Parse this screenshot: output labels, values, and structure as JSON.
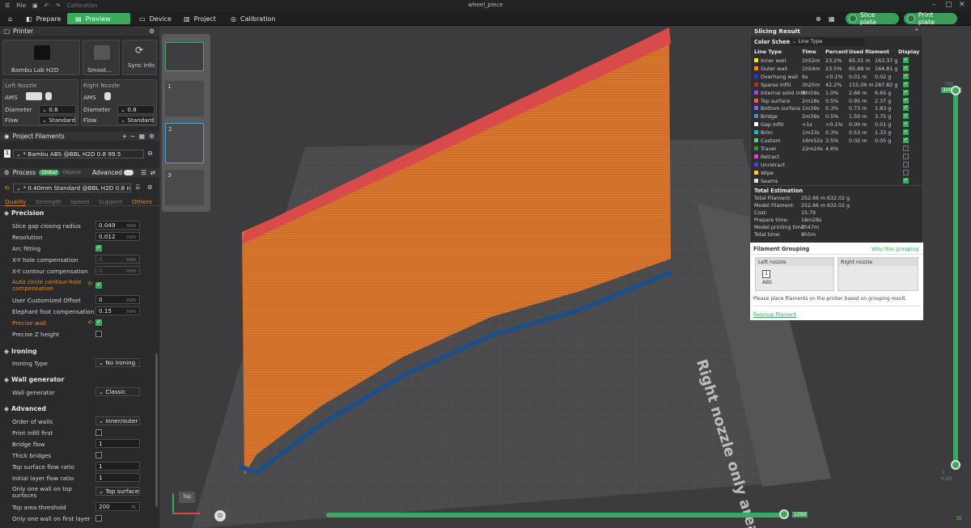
{
  "titlebar": {
    "file_menu": "File",
    "calibration": "Calibration",
    "title": "wheel_piece"
  },
  "tabs": {
    "prepare": "Prepare",
    "preview": "Preview",
    "device": "Device",
    "project": "Project",
    "calibration": "Calibration"
  },
  "actions": {
    "slice_plate": "Slice plate",
    "print_plate": "Print plate"
  },
  "printer": {
    "header": "Printer",
    "model": "Bambu Lab H2D",
    "plate": "Smoot...",
    "sync": "Sync info",
    "left_nozzle": {
      "title": "Left Nozzle",
      "ams": "AMS",
      "diameter_label": "Diameter",
      "diameter": "0.8",
      "flow_label": "Flow",
      "flow": "Standard"
    },
    "right_nozzle": {
      "title": "Right Nozzle",
      "ams": "AMS",
      "diameter_label": "Diameter",
      "diameter": "0.8",
      "flow_label": "Flow",
      "flow": "Standard"
    }
  },
  "filaments": {
    "header": "Project Filaments",
    "item_index": "1",
    "item": "* Bambu ABS @BBL H2D 0.8 99.5"
  },
  "process": {
    "header": "Process",
    "global": "Global",
    "objects": "Objects",
    "advanced": "Advanced",
    "preset": "* 0.40mm Standard @BBL H2D 0.8 noz...",
    "tabs": [
      "Quality",
      "Strength",
      "Speed",
      "Support",
      "Others"
    ]
  },
  "settings": {
    "precision": "Precision",
    "slice_gap_label": "Slice gap closing radius",
    "slice_gap": "0.049",
    "unit_mm": "mm",
    "resolution_label": "Resolution",
    "resolution": "0.012",
    "arc_fitting_label": "Arc fitting",
    "xy_hole_label": "X-Y hole compensation",
    "xy_hole": "0",
    "xy_contour_label": "X-Y contour compensation",
    "xy_contour": "0",
    "auto_circle_label": "Auto circle contour-hole compensation",
    "user_offset_label": "User Customized Offset",
    "user_offset": "0",
    "elephant_label": "Elephant foot compensation",
    "elephant": "0.15",
    "precise_wall_label": "Precise wall",
    "precise_z_label": "Precise Z height",
    "ironing": "Ironing",
    "ironing_type_label": "Ironing Type",
    "ironing_type": "No ironing",
    "wall_gen": "Wall generator",
    "wall_gen_label": "Wall generator",
    "wall_gen_value": "Classic",
    "advanced": "Advanced",
    "order_walls_label": "Order of walls",
    "order_walls": "inner/outer",
    "infill_first_label": "Print infill first",
    "bridge_flow_label": "Bridge flow",
    "bridge_flow": "1",
    "thick_bridges_label": "Thick bridges",
    "top_flow_label": "Top surface flow ratio",
    "top_flow": "1",
    "initial_flow_label": "Initial layer flow ratio",
    "initial_flow": "1",
    "one_wall_top_label": "Only one wall on top surfaces",
    "one_wall_top": "Top surfaces",
    "top_area_label": "Top area threshold",
    "top_area": "200",
    "unit_pct": "%",
    "one_wall_first_label": "Only one wall on first layer"
  },
  "plates": [
    "1",
    "2",
    "3"
  ],
  "viewport": {
    "right_nozzle_text": "Right nozzle only area",
    "layer_top": "750",
    "layer_top_h": "300.00",
    "layer_bottom": "1",
    "layer_bottom_h": "0.40",
    "move_value": "1290",
    "view_label": "Top"
  },
  "slicing": {
    "header": "Slicing Result",
    "color_scheme_label": "Color Scheme",
    "color_scheme": "Line Type",
    "cols": [
      "Line Type",
      "Time",
      "Percent",
      "Used filament",
      "",
      "Display"
    ],
    "rows": [
      {
        "name": "Inner wall",
        "color": "#e8e63a",
        "time": "1h52m",
        "pct": "23.2%",
        "m": "65.31 m",
        "g": "163.37 g",
        "on": true
      },
      {
        "name": "Outer wall",
        "color": "#f28c1a",
        "time": "1h54m",
        "pct": "23.5%",
        "m": "65.88 m",
        "g": "164.81 g",
        "on": true
      },
      {
        "name": "Overhang wall",
        "color": "#2a33d8",
        "time": "6s",
        "pct": "<0.1%",
        "m": "0.01 m",
        "g": "0.02 g",
        "on": true
      },
      {
        "name": "Sparse infill",
        "color": "#b03030",
        "time": "3h25m",
        "pct": "42.2%",
        "m": "115.06 m",
        "g": "287.82 g",
        "on": true
      },
      {
        "name": "Internal solid infill",
        "color": "#9a4fcf",
        "time": "4m59s",
        "pct": "1.0%",
        "m": "2.66 m",
        "g": "6.65 g",
        "on": true
      },
      {
        "name": "Top surface",
        "color": "#f25a5a",
        "time": "2m18s",
        "pct": "0.5%",
        "m": "0.95 m",
        "g": "2.37 g",
        "on": true
      },
      {
        "name": "Bottom surface",
        "color": "#6a6aff",
        "time": "1m39s",
        "pct": "0.3%",
        "m": "0.73 m",
        "g": "1.83 g",
        "on": true
      },
      {
        "name": "Bridge",
        "color": "#4d88c6",
        "time": "2m39s",
        "pct": "0.5%",
        "m": "1.50 m",
        "g": "3.75 g",
        "on": true
      },
      {
        "name": "Gap infill",
        "color": "#ffffff",
        "time": "<1s",
        "pct": "<0.1%",
        "m": "0.00 m",
        "g": "0.01 g",
        "on": true
      },
      {
        "name": "Brim",
        "color": "#00c4c4",
        "time": "1m33s",
        "pct": "0.3%",
        "m": "0.53 m",
        "g": "1.33 g",
        "on": true
      },
      {
        "name": "Custom",
        "color": "#5ec98b",
        "time": "16m52s",
        "pct": "3.5%",
        "m": "0.02 m",
        "g": "0.05 g",
        "on": true
      },
      {
        "name": "Travel",
        "color": "#3a8f3a",
        "time": "22m24s",
        "pct": "4.6%",
        "m": "",
        "g": "",
        "on": false
      },
      {
        "name": "Retract",
        "color": "#e040e0",
        "time": "",
        "pct": "",
        "m": "",
        "g": "",
        "on": false
      },
      {
        "name": "Unretract",
        "color": "#4040ff",
        "time": "",
        "pct": "",
        "m": "",
        "g": "",
        "on": false
      },
      {
        "name": "Wipe",
        "color": "#ffd200",
        "time": "",
        "pct": "",
        "m": "",
        "g": "",
        "on": false
      },
      {
        "name": "Seams",
        "color": "#e0e0e0",
        "time": "",
        "pct": "",
        "m": "",
        "g": "",
        "on": true
      }
    ],
    "est_header": "Total Estimation",
    "est": [
      {
        "k": "Total Filament:",
        "a": "252.66 m",
        "b": "632.02 g"
      },
      {
        "k": "Model Filament:",
        "a": "252.66 m",
        "b": "632.02 g"
      },
      {
        "k": "Cost:",
        "a": "15.79",
        "b": ""
      },
      {
        "k": "Prepare time:",
        "a": "18m28s",
        "b": ""
      },
      {
        "k": "Model printing time:",
        "a": "7h47m",
        "b": ""
      },
      {
        "k": "Total time:",
        "a": "8h5m",
        "b": ""
      }
    ]
  },
  "grouping": {
    "header": "Filament Grouping",
    "why": "Why this grouping",
    "left": "Left nozzle",
    "right": "Right nozzle",
    "slot": "1",
    "slot_name": "ABS",
    "note": "Please place filaments on the printer based on grouping result.",
    "regroup": "Regroup filament"
  }
}
